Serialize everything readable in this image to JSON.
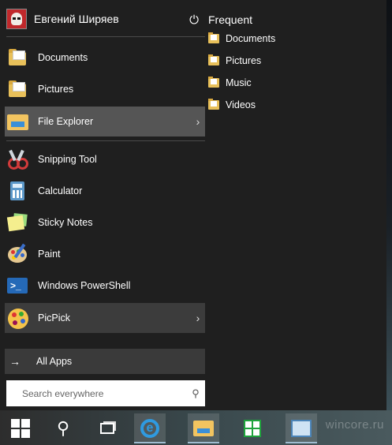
{
  "user": {
    "name": "Евгений Ширяев",
    "avatar": "stormtrooper-avatar"
  },
  "pinned": [
    {
      "label": "Documents",
      "icon": "documents-folder-icon"
    },
    {
      "label": "Pictures",
      "icon": "pictures-folder-icon"
    },
    {
      "label": "File Explorer",
      "icon": "file-explorer-icon",
      "has_submenu": true,
      "chevron": "›"
    }
  ],
  "apps": [
    {
      "label": "Snipping Tool",
      "icon": "snipping-tool-icon"
    },
    {
      "label": "Calculator",
      "icon": "calculator-icon"
    },
    {
      "label": "Sticky Notes",
      "icon": "sticky-notes-icon"
    },
    {
      "label": "Paint",
      "icon": "paint-icon"
    },
    {
      "label": "Windows PowerShell",
      "icon": "powershell-icon"
    },
    {
      "label": "PicPick",
      "icon": "picpick-icon",
      "has_submenu": true,
      "chevron": "›"
    }
  ],
  "all_apps": {
    "label": "All Apps",
    "arrow": "→"
  },
  "search": {
    "placeholder": "Search everywhere",
    "value": "",
    "icon_glyph": "⚲"
  },
  "power": {
    "glyph": "⏻"
  },
  "frequent": {
    "title": "Frequent",
    "items": [
      {
        "label": "Documents"
      },
      {
        "label": "Pictures"
      },
      {
        "label": "Music"
      },
      {
        "label": "Videos"
      }
    ]
  },
  "taskbar": {
    "items": [
      "start-button",
      "search-button",
      "task-view-button",
      "internet-explorer",
      "file-explorer",
      "windows-store",
      "remote-desktop"
    ],
    "search_glyph": "⚲",
    "ie_glyph": "e"
  },
  "watermark": "wincore.ru",
  "colors": {
    "menu_bg": "#1f1f1f",
    "highlight": "#555555",
    "all_apps_bg": "#3a3a3a",
    "folder": "#e8c05a",
    "ie_blue": "#2f9ae0",
    "store_green": "#1fa33c"
  }
}
